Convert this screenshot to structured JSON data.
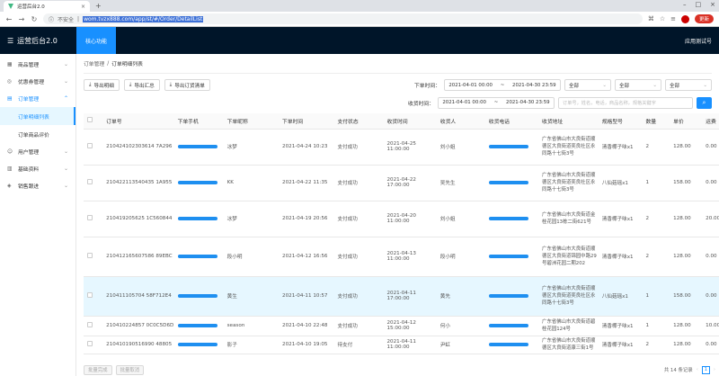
{
  "browser": {
    "tab_title": "运营后台2.0",
    "security": "不安全",
    "url": "wom.tvzx888.com/app/st/#/Order/DetailList",
    "update_label": "更新"
  },
  "app": {
    "logo_text": "运营后台2.0",
    "top_nav": "核心功能",
    "user": "应用测试号"
  },
  "sidebar": {
    "items": [
      {
        "label": "商品管理"
      },
      {
        "label": "优惠券管理"
      },
      {
        "label": "订单管理"
      }
    ],
    "subitems": [
      {
        "label": "订单明细列表"
      },
      {
        "label": "订单商品评价"
      }
    ],
    "items2": [
      {
        "label": "用户管理"
      },
      {
        "label": "基础资料"
      },
      {
        "label": "销售跟进"
      }
    ]
  },
  "breadcrumb": {
    "parent": "订单管理",
    "sep": "/",
    "current": "订单明细列表"
  },
  "toolbar": {
    "export_detail": "导出明细",
    "export_summary": "导出汇总",
    "export_order": "导出订货清单"
  },
  "filters": {
    "order_time_label": "下单时间：",
    "order_start": "2021-04-01 00:00",
    "order_end": "2021-04-30 23:59",
    "range_sep": "~",
    "pay_time_label": "收货时间：",
    "pay_start": "2021-04-01 00:00",
    "pay_end": "2021-04-30 23:59",
    "sel1": "全部",
    "sel2": "全部",
    "sel3": "全部",
    "search_placeholder": "订单号，姓名，电话，商品名称，规格关键字"
  },
  "table": {
    "headers": [
      "订单号",
      "下单手机",
      "下单昵称",
      "下单时间",
      "支付状态",
      "收货时间",
      "收货人",
      "收货电话",
      "收货地址",
      "规格型号",
      "数量",
      "单价",
      "运费"
    ],
    "rows": [
      {
        "order": "210424102303614 7A296",
        "nick": "冰梦",
        "time": "2021-04-24 10:23",
        "status": "支付成功",
        "recv": "2021-04-25 11:00:00",
        "name": "刘小姐",
        "addr": "广东省佛山市大良街道顺德区大良街道奕良社区永同路十七街3号",
        "spec": "清香椰子味x1",
        "qty": "2",
        "price": "128.00",
        "ship": "0.00"
      },
      {
        "order": "210422113540435 1A955",
        "nick": "KK",
        "time": "2021-04-22 11:35",
        "status": "支付成功",
        "recv": "2021-04-22 17:00:00",
        "name": "吴先生",
        "addr": "广东省佛山市大良街道顺德区大良街道奕良社区永同路十七街3号",
        "spec": "八仙菇瑶x1",
        "qty": "1",
        "price": "158.00",
        "ship": "0.00"
      },
      {
        "order": "210419205625 1C560844",
        "nick": "冰梦",
        "time": "2021-04-19 20:56",
        "status": "支付成功",
        "recv": "2021-04-20 11:00:00",
        "name": "刘小姐",
        "addr": "广东省佛山市大良街道金桂花园13栋二街621号",
        "spec": "清香椰子味x1",
        "qty": "2",
        "price": "128.00",
        "ship": "20.00"
      },
      {
        "order": "210412165607586 89EBC",
        "nick": "段小明",
        "time": "2021-04-12 16:56",
        "status": "支付成功",
        "recv": "2021-04-13 11:00:00",
        "name": "段小明",
        "addr": "广东省佛山市大良街道顺德区大良街道锦园中路29号碧洲花园二期202",
        "spec": "清香椰子味x1",
        "qty": "2",
        "price": "128.00",
        "ship": "0.00"
      },
      {
        "order": "210411105704 58F712E4",
        "nick": "黄生",
        "time": "2021-04-11 10:57",
        "status": "支付成功",
        "recv": "2021-04-11 17:00:00",
        "name": "黄先",
        "addr": "广东省佛山市大良街道顺德区大良街道奕良社区永同路十七街3号",
        "spec": "八仙菇瑶x1",
        "qty": "1",
        "price": "158.00",
        "ship": "0.00"
      },
      {
        "order": "210410224857 0C0C5D6D",
        "nick": "season",
        "time": "2021-04-10 22:48",
        "status": "支付成功",
        "recv": "2021-04-12 15:00:00",
        "name": "何小",
        "addr": "广东省佛山市大良街道碧桂花园124号",
        "spec": "清香椰子味x1",
        "qty": "1",
        "price": "128.00",
        "ship": "10.00"
      },
      {
        "order": "210410190516990 48805",
        "nick": "影子",
        "time": "2021-04-10 19:05",
        "status": "待支付",
        "recv": "2021-04-11 11:00:00",
        "name": "尹虹",
        "addr": "广东省佛山市大良街道顺德区大良街道康三街1号",
        "spec": "清香椰子味x1",
        "qty": "2",
        "price": "128.00",
        "ship": "0.00"
      }
    ]
  },
  "footer": {
    "batch_done": "批量完成",
    "batch_cancel": "批量取消",
    "total": "共 14 条记录",
    "page": "1"
  }
}
